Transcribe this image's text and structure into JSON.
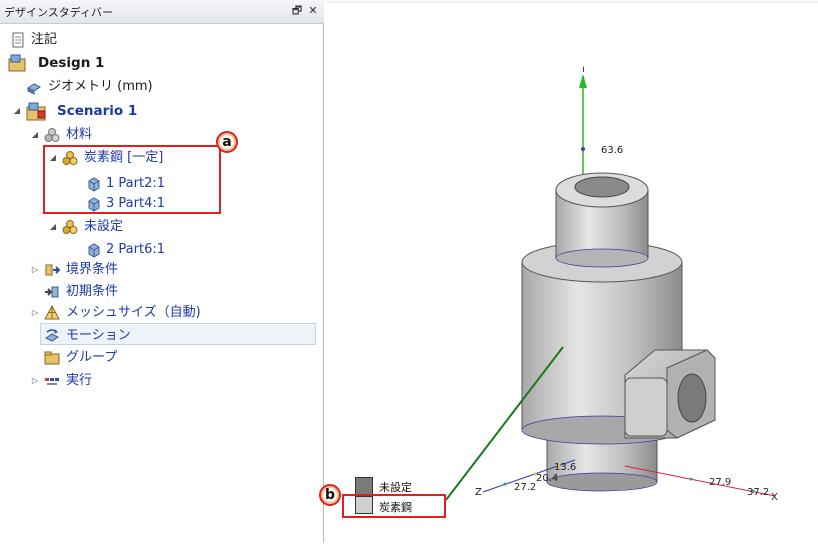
{
  "panel": {
    "title": "デザインスタディバー",
    "pin_glyph": "🗗",
    "close_glyph": "✕"
  },
  "tree": {
    "notes": "注記",
    "design": "Design 1",
    "geometry": "ジオメトリ (mm)",
    "scenario": "Scenario 1",
    "materials": "材料",
    "carbon_steel": "炭素鋼 [一定]",
    "part_a": "1 Part2:1",
    "part_b": "3 Part4:1",
    "unset": "未設定",
    "part_c": "2 Part6:1",
    "boundary": "境界条件",
    "initial": "初期条件",
    "mesh": "メッシュサイズ（自動)",
    "motion": "モーション",
    "group": "グループ",
    "run": "実行"
  },
  "callouts": {
    "a": "a",
    "b": "b"
  },
  "legend": {
    "items": [
      {
        "label": "未設定",
        "color": "#7a7a7a"
      },
      {
        "label": "炭素鋼",
        "color": "#d0d0d0"
      }
    ]
  },
  "axes": {
    "y_top": "63.6",
    "z_ticks": [
      "13.6",
      "20.4",
      "27.2"
    ],
    "x_ticks": [
      "27.9",
      "37.2"
    ],
    "z_name": "Z",
    "x_name": "X"
  },
  "colors": {
    "highlight_red": "#e02020",
    "link_blue": "#1c3aa8",
    "y_axis": "#22bb22",
    "x_axis": "#cc2244",
    "leader_line": "#1a7a1a"
  },
  "icons": [
    "notes-icon",
    "design-icon",
    "geometry-icon",
    "scenario-icon",
    "materials-icon",
    "part-icon",
    "boundary-icon",
    "initial-icon",
    "mesh-icon",
    "motion-icon",
    "group-icon",
    "run-icon"
  ]
}
